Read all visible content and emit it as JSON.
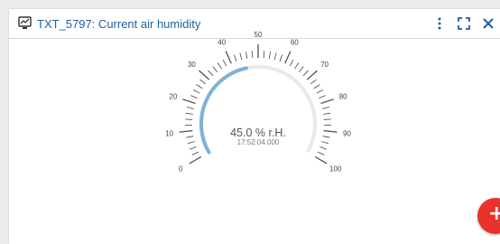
{
  "widget": {
    "title": "TXT_5797: Current air humidity",
    "icons": {
      "title": "chart-icon",
      "menu": "more-vert-icon",
      "fullscreen": "fullscreen-icon",
      "close": "close-icon"
    }
  },
  "gauge": {
    "min": 0,
    "max": 100,
    "value": 45.0,
    "unit": "% r.H.",
    "value_text": "45.0 % r.H.",
    "timestamp": "17:52:04.000",
    "tick_labels": [
      "0",
      "10",
      "20",
      "30",
      "40",
      "50",
      "60",
      "70",
      "80",
      "90",
      "100"
    ],
    "colors": {
      "value_arc": "#7fb2d7",
      "track": "#e9e9e9",
      "ticks": "#444444"
    }
  },
  "fab": {
    "icon": "plus-icon",
    "label": "+"
  }
}
